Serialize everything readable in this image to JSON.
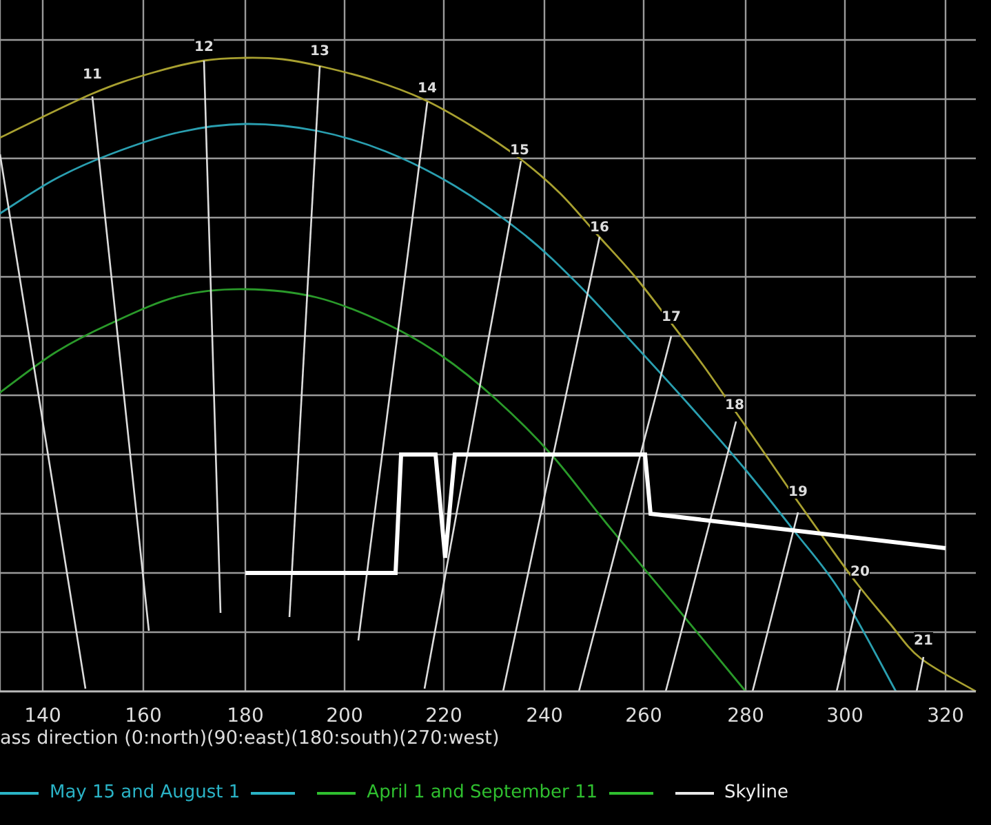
{
  "chart": {
    "hour_labels": [
      "11",
      "12",
      "13",
      "14",
      "15",
      "16",
      "17",
      "18",
      "19",
      "20",
      "21"
    ],
    "x_tick_labels": [
      "140",
      "160",
      "180",
      "200",
      "220",
      "240",
      "260",
      "280",
      "300",
      "320"
    ],
    "x_axis_title": "ass direction (0:north)(90:east)(180:south)(270:west)"
  },
  "legend": [
    {
      "label": "May 15 and August 1",
      "color": "#2ab3c6",
      "kind": "double"
    },
    {
      "label": "April 1 and September 11",
      "color": "#2fbf2f",
      "kind": "double"
    },
    {
      "label": "Skyline",
      "color": "#e8e8e8",
      "kind": "single"
    }
  ]
}
